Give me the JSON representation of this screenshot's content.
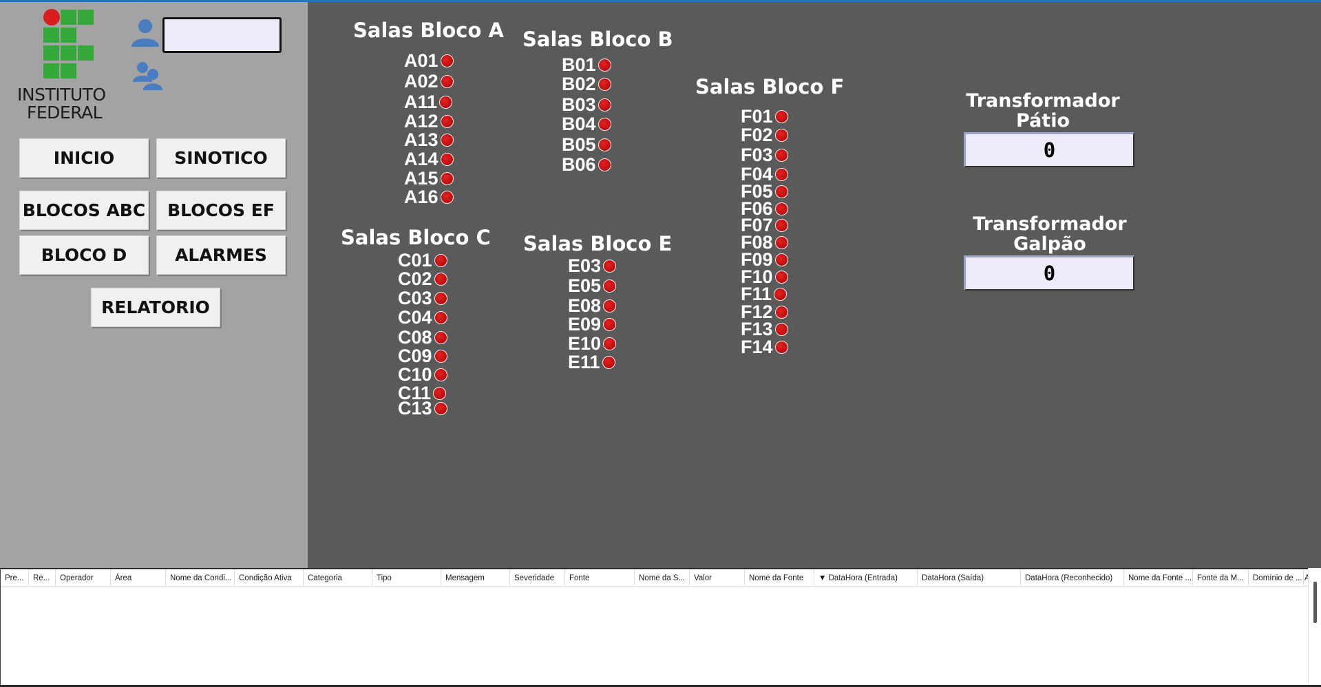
{
  "logo": {
    "line1": "INSTITUTO",
    "line2": "FEDERAL"
  },
  "login": {
    "value": ""
  },
  "nav": {
    "inicio": "INICIO",
    "sinotico": "SINOTICO",
    "blocos_abc": "BLOCOS ABC",
    "blocos_ef": "BLOCOS EF",
    "bloco_d": "BLOCO D",
    "alarmes": "ALARMES",
    "relatorio": "RELATORIO"
  },
  "blocks": {
    "a": {
      "title": "Salas Bloco A",
      "rooms": [
        "A01",
        "A02",
        "A11",
        "A12",
        "A13",
        "A14",
        "A15",
        "A16"
      ]
    },
    "b": {
      "title": "Salas Bloco B",
      "rooms": [
        "B01",
        "B02",
        "B03",
        "B04",
        "B05",
        "B06"
      ]
    },
    "c": {
      "title": "Salas Bloco C",
      "rooms": [
        "C01",
        "C02",
        "C03",
        "C04",
        "C08",
        "C09",
        "C10",
        "C11",
        "C13"
      ]
    },
    "e": {
      "title": "Salas Bloco E",
      "rooms": [
        "E03",
        "E05",
        "E08",
        "E09",
        "E10",
        "E11"
      ]
    },
    "f": {
      "title": "Salas Bloco F",
      "rooms": [
        "F01",
        "F02",
        "F03",
        "F04",
        "F05",
        "F06",
        "F07",
        "F08",
        "F09",
        "F10",
        "F11",
        "F12",
        "F13",
        "F14"
      ]
    }
  },
  "transformers": {
    "patio": {
      "title_line1": "Transformador",
      "title_line2": "Pátio",
      "value": "0"
    },
    "galpao": {
      "title_line1": "Transformador",
      "title_line2": "Galpão",
      "value": "0"
    }
  },
  "alarm_grid": {
    "columns": [
      "Pre...",
      "Re...",
      "Operador",
      "Área",
      "Nome da Condi...",
      "Condição Ativa",
      "Categoria",
      "Tipo",
      "Mensagem",
      "Severidade",
      "Fonte",
      "Nome da S...",
      "Valor",
      "Nome da Fonte",
      "▼ DataHora (Entrada)",
      "DataHora (Saída)",
      "DataHora (Reconhecido)",
      "Nome da Fonte ...",
      "Fonte da M...",
      "Domínio de ...",
      "A"
    ]
  },
  "colors": {
    "background": "#5a5a5a",
    "sidebar": "#a3a3a3",
    "led_alarm": "#c21010",
    "accent_top": "#1e74c6",
    "logo_green": "#34a838",
    "logo_red": "#d81e1e"
  }
}
